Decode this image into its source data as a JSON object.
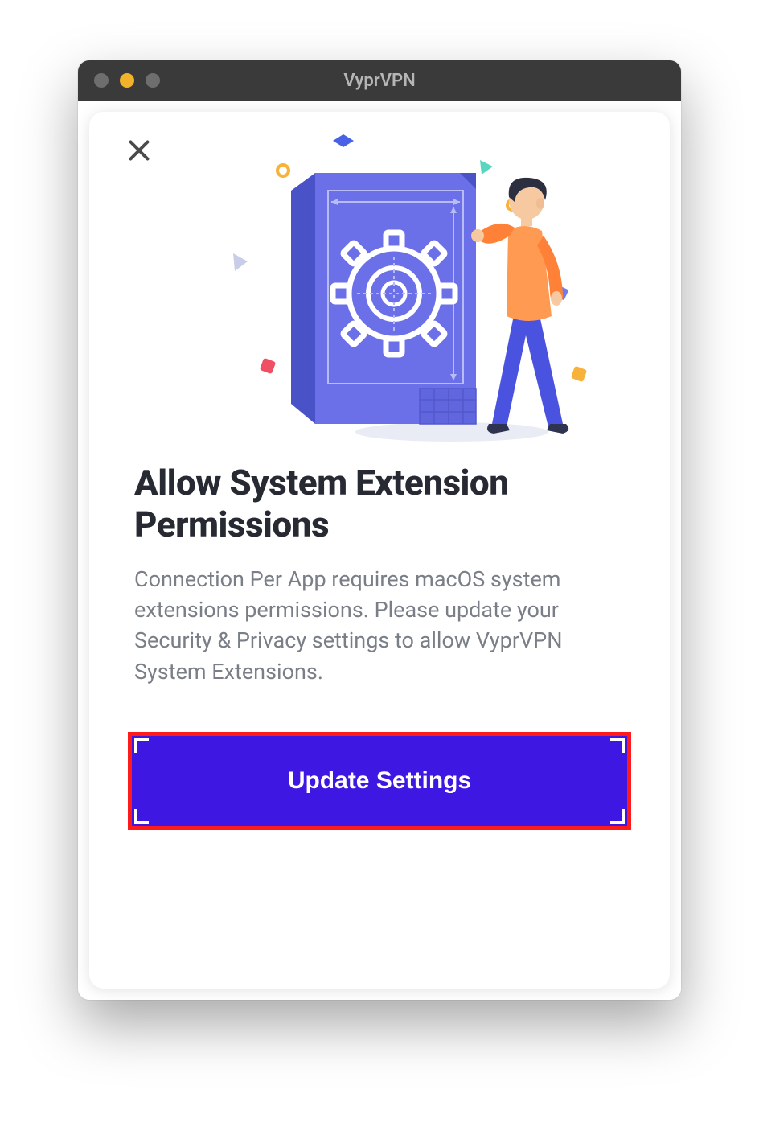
{
  "window": {
    "title": "VyprVPN"
  },
  "modal": {
    "heading": "Allow System Extension Permissions",
    "body": "Connection Per App requires macOS system extensions permissions. Please update your Security & Privacy settings to allow VyprVPN System Extensions.",
    "cta_label": "Update Settings"
  }
}
